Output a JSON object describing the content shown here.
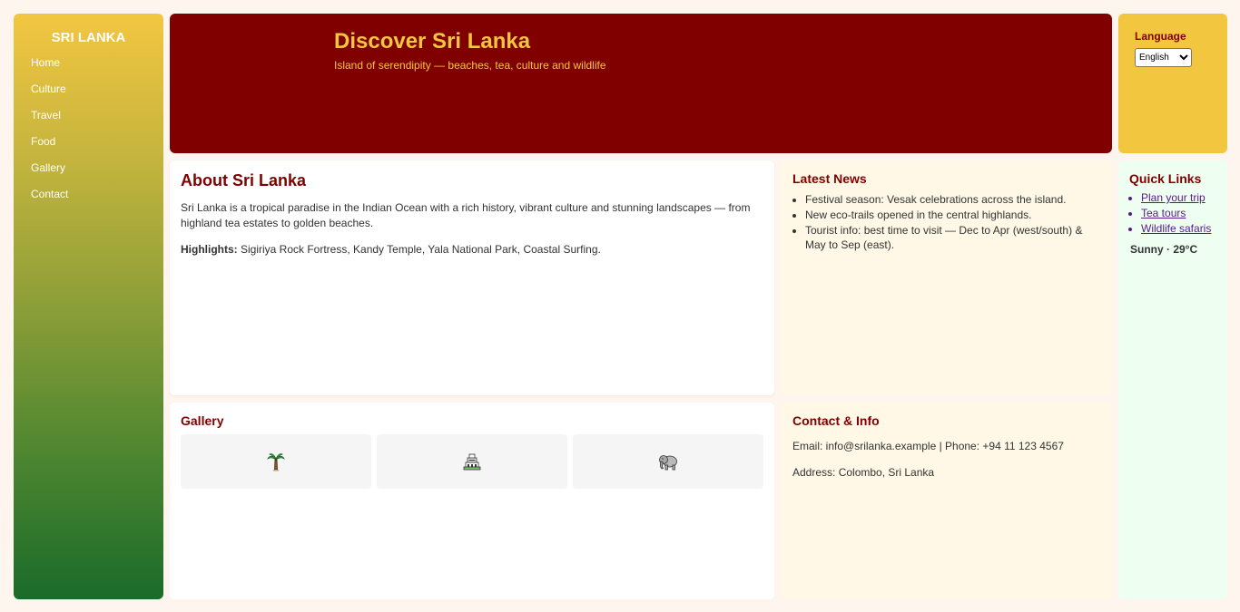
{
  "sidebar": {
    "brand": "SRI LANKA",
    "nav": [
      "Home",
      "Culture",
      "Travel",
      "Food",
      "Gallery",
      "Contact"
    ]
  },
  "hero": {
    "title": "Discover Sri Lanka",
    "subtitle": "Island of serendipity — beaches, tea, culture and wildlife"
  },
  "language": {
    "label": "Language",
    "selected": "English"
  },
  "about": {
    "title": "About Sri Lanka",
    "body": "Sri Lanka is a tropical paradise in the Indian Ocean with a rich history, vibrant culture and stunning landscapes — from highland tea estates to golden beaches.",
    "highlights_label": "Highlights:",
    "highlights": " Sigiriya Rock Fortress, Kandy Temple, Yala National Park, Coastal Surfing."
  },
  "news": {
    "title": "Latest News",
    "items": [
      "Festival season: Vesak celebrations across the island.",
      "New eco-trails opened in the central highlands.",
      "Tourist info: best time to visit — Dec to Apr (west/south) & May to Sep (east)."
    ]
  },
  "quick_links": {
    "title": "Quick Links",
    "items": [
      "Plan your trip",
      "Tea tours",
      "Wildlife safaris"
    ],
    "weather": "Sunny · 29°C"
  },
  "gallery": {
    "title": "Gallery",
    "icons": [
      "palm-tree-icon",
      "temple-icon",
      "elephant-icon"
    ]
  },
  "contact": {
    "title": "Contact & Info",
    "line1": "Email: info@srilanka.example | Phone: +94 11 123 4567",
    "line2": "Address: Colombo, Sri Lanka"
  },
  "colors": {
    "maroon": "#800000",
    "gold": "#f3c640",
    "green": "#1a6b2a",
    "cream": "#fff8e6",
    "mint": "#eefff2",
    "link": "#551a8b"
  }
}
